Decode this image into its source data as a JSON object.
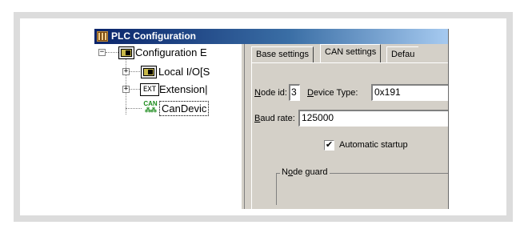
{
  "window": {
    "title": "PLC Configuration",
    "icon": "plc-config-icon"
  },
  "tree": {
    "root": {
      "label": "Configuration E",
      "expander": "⊟",
      "icon": "module-icon"
    },
    "children": [
      {
        "label": "Local I/O[S",
        "expander": "⊞",
        "icon": "module-icon"
      },
      {
        "label": "Extension|",
        "expander": "⊞",
        "icon": "ext-icon",
        "icon_text": "EXT"
      },
      {
        "label": "CanDevic",
        "icon": "can-device-icon",
        "icon_text": "CAN",
        "selected": true
      }
    ]
  },
  "tabs": [
    {
      "label": "Base settings"
    },
    {
      "label": "CAN settings",
      "active": true
    },
    {
      "label": "Defau"
    }
  ],
  "can_settings": {
    "node_id": {
      "label_u": "N",
      "label_rest": "ode id:",
      "value": "3"
    },
    "device_type": {
      "label_u": "D",
      "label_rest": "evice Type:",
      "value": "0x191"
    },
    "baud_rate": {
      "label_u": "B",
      "label_rest": "aud rate:",
      "value": "125000"
    },
    "automatic_startup": {
      "label": "Automatic startup",
      "checked": true,
      "mark": "✔"
    },
    "node_guard": {
      "label_pre": "N",
      "label_u": "o",
      "label_rest": "de guard"
    }
  },
  "scrollbar": {
    "left_arrow": "left-arrow-icon",
    "right_arrow": "right-arrow-icon"
  }
}
